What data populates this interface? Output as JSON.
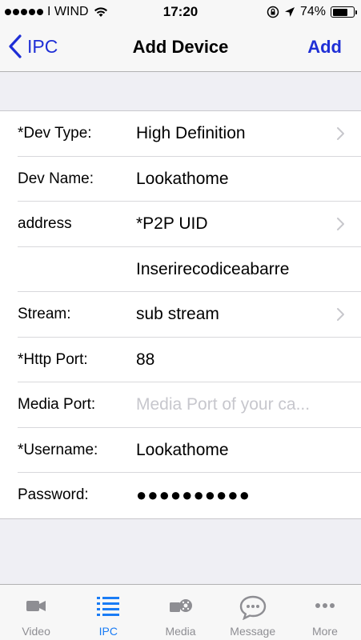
{
  "status_bar": {
    "carrier": "I WIND",
    "time": "17:20",
    "battery": "74%",
    "battery_level": 0.74
  },
  "nav": {
    "back_label": "IPC",
    "title": "Add Device",
    "action_label": "Add",
    "accent_color": "#1f2fd6"
  },
  "form": {
    "rows": [
      {
        "label": "*Dev Type:",
        "value": "High Definition",
        "chevron": true
      },
      {
        "label": "Dev Name:",
        "value": "Lookathome",
        "chevron": false
      },
      {
        "label": "address",
        "value": "*P2P UID",
        "chevron": true
      },
      {
        "label": "",
        "value": "Inserirecodiceabarre",
        "chevron": false
      },
      {
        "label": "Stream:",
        "value": "sub stream",
        "chevron": true
      },
      {
        "label": "*Http Port:",
        "value": "88",
        "chevron": false
      },
      {
        "label": "Media Port:",
        "placeholder": "Media Port of your ca...",
        "chevron": false
      },
      {
        "label": "*Username:",
        "value": "Lookathome",
        "chevron": false
      },
      {
        "label": "Password:",
        "value": "●●●●●●●●●●",
        "chevron": false
      }
    ]
  },
  "tab_bar": {
    "tabs": [
      {
        "label": "Video",
        "icon": "video-camera-icon"
      },
      {
        "label": "IPC",
        "icon": "list-icon",
        "active": true
      },
      {
        "label": "Media",
        "icon": "media-icon"
      },
      {
        "label": "Message",
        "icon": "message-bubble-icon"
      },
      {
        "label": "More",
        "icon": "more-dots-icon"
      }
    ],
    "active_color": "#1a7cf5",
    "inactive_color": "#8e8e93"
  }
}
